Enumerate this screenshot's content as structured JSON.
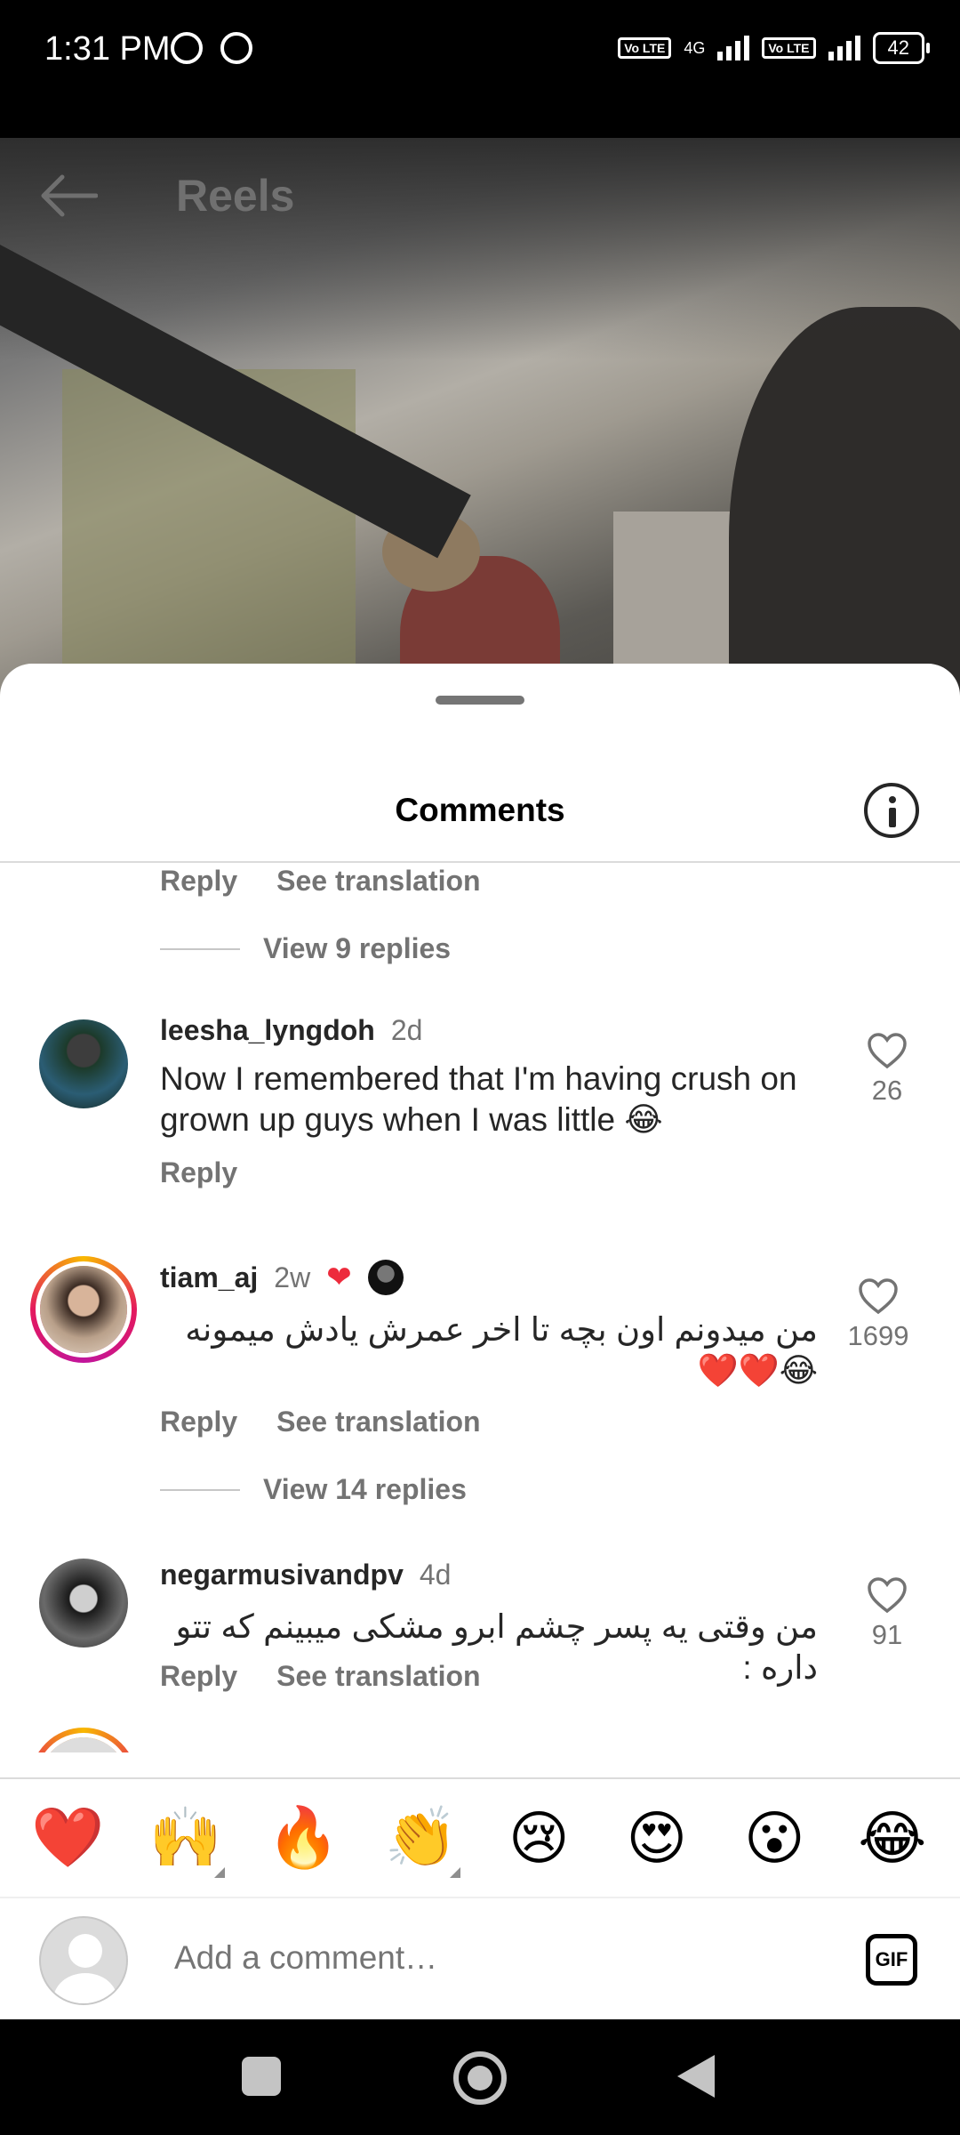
{
  "status_bar": {
    "time": "1:31 PM",
    "network": "4G",
    "battery": "42",
    "volte1": "Vo LTE",
    "volte2": "Vo LTE"
  },
  "header": {
    "title": "Reels"
  },
  "sheet": {
    "title": "Comments"
  },
  "comments": {
    "top_actions": {
      "reply": "Reply",
      "translate": "See translation"
    },
    "top_replies": "View 9 replies",
    "items": [
      {
        "username": "leesha_lyngdoh",
        "time": "2d",
        "text": "Now I remembered that I'm having crush on grown up guys when I was little 😂",
        "likes": "26",
        "reply": "Reply"
      },
      {
        "username": "tiam_aj",
        "time": "2w",
        "text": "من میدونم اون بچه تا اخر عمرش یادش میمونه😂❤️❤️",
        "likes": "1699",
        "reply": "Reply",
        "translate": "See translation",
        "replies": "View 14 replies"
      },
      {
        "username": "negarmusivandpv",
        "time": "4d",
        "text": "من وقتی یه پسر چشم ابرو مشکی میبینم که تتو داره :",
        "likes": "91",
        "reply": "Reply",
        "translate": "See translation"
      }
    ]
  },
  "emoji_bar": [
    "❤️",
    "🙌",
    "🔥",
    "👏",
    "😢",
    "😍",
    "😮",
    "😂"
  ],
  "input": {
    "placeholder": "Add a comment…",
    "gif": "GIF"
  },
  "colors": {
    "like_red": "#ed2b3c",
    "secondary_text": "#737373"
  }
}
